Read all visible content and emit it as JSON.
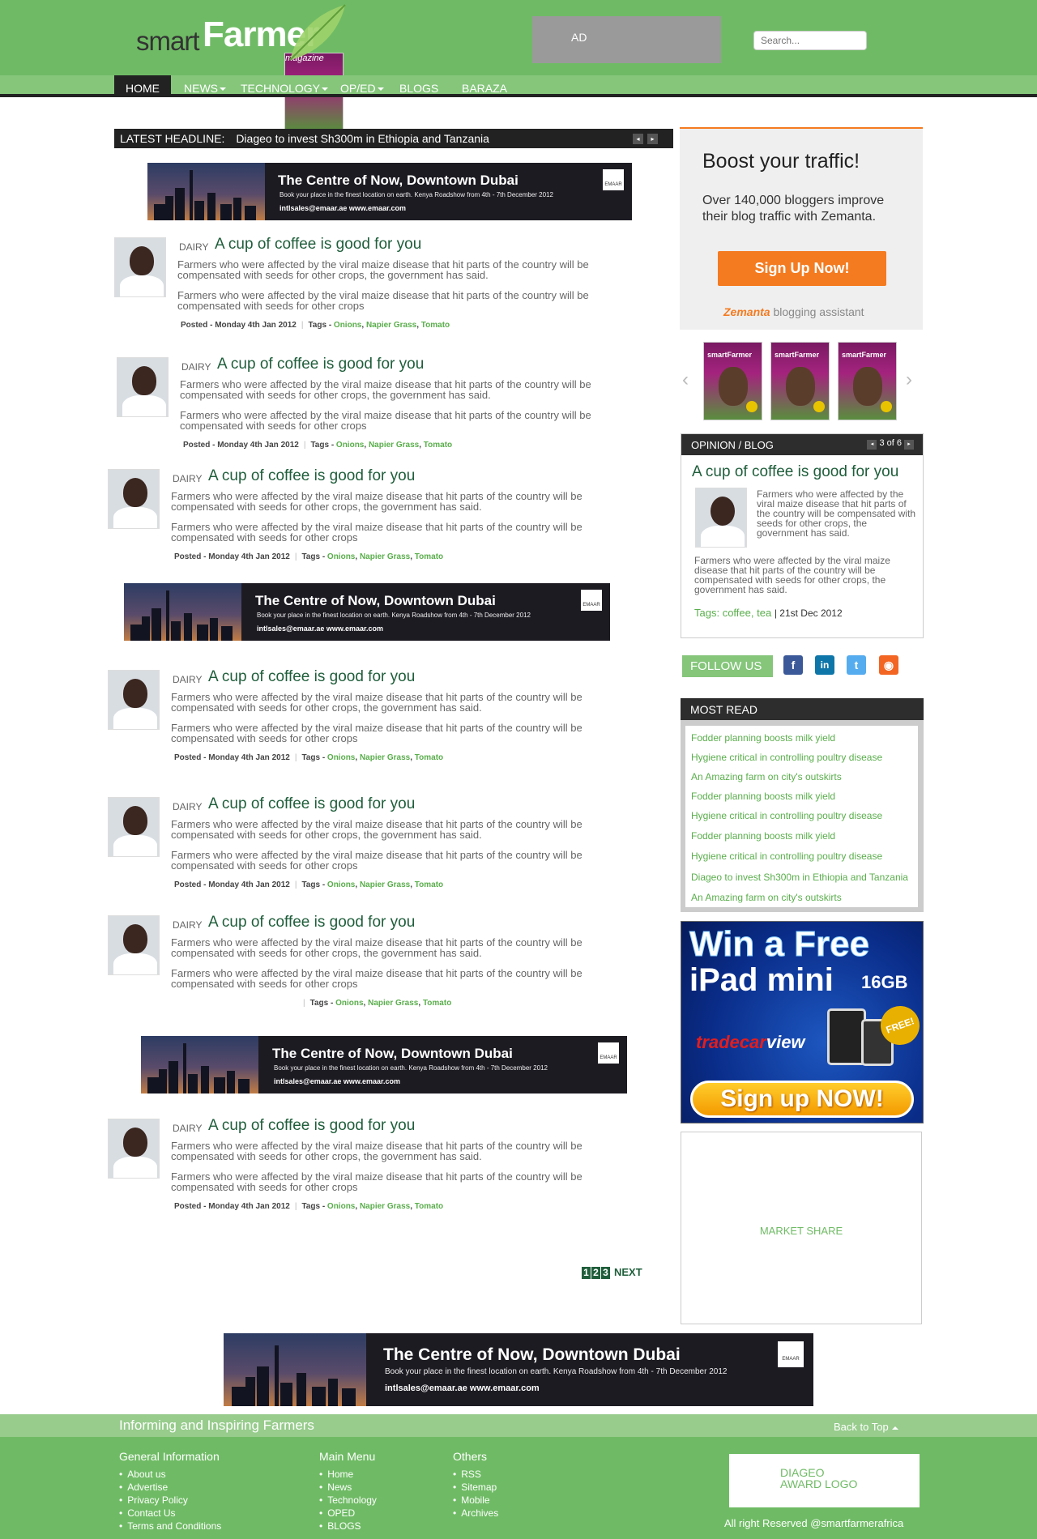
{
  "header": {
    "logo_smart": "smart",
    "logo_farmer": "Farmer",
    "logo_magazine": "magazine",
    "ad_label": "AD",
    "search_placeholder": "Search..."
  },
  "nav": {
    "items": [
      {
        "label": "HOME",
        "dropdown": false,
        "active": true
      },
      {
        "label": "NEWS",
        "dropdown": true
      },
      {
        "label": "TECHNOLOGY",
        "dropdown": true
      },
      {
        "label": "OP/ED",
        "dropdown": true
      },
      {
        "label": "BLOGS",
        "dropdown": false
      },
      {
        "label": "BARAZA",
        "dropdown": false
      }
    ]
  },
  "headline": {
    "label": "LATEST HEADLINE:",
    "text": "Diageo to invest Sh300m in Ethiopia and Tanzania",
    "prev": "◂",
    "next": "▸"
  },
  "banner": {
    "title": "The Centre of Now, Downtown Dubai",
    "subtitle": "Book your place in the finest location on earth. Kenya Roadshow from 4th - 7th December 2012",
    "contact": "intlsales@emaar.ae  www.emaar.com",
    "brand": "EMAAR"
  },
  "articles": [
    {
      "category": "DAIRY",
      "title": "A cup of coffee is good for you",
      "para1": "Farmers who were affected by the viral maize disease that hit parts of the country will be compensated with seeds for other crops, the government has said.",
      "para2": "Farmers who were affected by the viral maize disease that hit parts of the country will be compensated with seeds for other crops",
      "posted": "Posted - Monday 4th Jan 2012",
      "tags_label": "Tags - ",
      "tags": [
        "Onions",
        "Napier Grass",
        "Tomato"
      ]
    },
    {
      "category": "DAIRY",
      "title": "A cup of coffee is good for you",
      "para1": "Farmers who were affected by the viral maize disease that hit parts of the country will be compensated with seeds for other crops, the government has said.",
      "para2": "Farmers who were affected by the viral maize disease that hit parts of the country will be compensated with seeds for other crops",
      "posted": "Posted - Monday 4th Jan 2012",
      "tags_label": "Tags - ",
      "tags": [
        "Onions",
        "Napier Grass",
        "Tomato"
      ]
    },
    {
      "category": "DAIRY",
      "title": "A cup of coffee is good for you",
      "para1": "Farmers who were affected by the viral maize disease that hit parts of the country will be compensated with seeds for other crops, the government has said.",
      "para2": "Farmers who were affected by the viral maize disease that hit parts of the country will be compensated with seeds for other crops",
      "posted": "Posted - Monday 4th Jan 2012",
      "tags_label": "Tags - ",
      "tags": [
        "Onions",
        "Napier Grass",
        "Tomato"
      ]
    },
    {
      "category": "DAIRY",
      "title": "A cup of coffee is good for you",
      "para1": "Farmers who were affected by the viral maize disease that hit parts of the country will be compensated with seeds for other crops, the government has said.",
      "para2": "Farmers who were affected by the viral maize disease that hit parts of the country will be compensated with seeds for other crops",
      "posted": "Posted - Monday 4th Jan 2012",
      "tags_label": "Tags - ",
      "tags": [
        "Onions",
        "Napier Grass",
        "Tomato"
      ]
    },
    {
      "category": "DAIRY",
      "title": "A cup of coffee is good for you",
      "para1": "Farmers who were affected by the viral maize disease that hit parts of the country will be compensated with seeds for other crops, the government has said.",
      "para2": "Farmers who were affected by the viral maize disease that hit parts of the country will be compensated with seeds for other crops",
      "posted": "Posted - Monday 4th Jan 2012",
      "tags_label": "Tags - ",
      "tags": [
        "Onions",
        "Napier Grass",
        "Tomato"
      ]
    },
    {
      "category": "DAIRY",
      "title": "A cup of coffee is good for you",
      "para1": "Farmers who were affected by the viral maize disease that hit parts of the country will be compensated with seeds for other crops, the government has said.",
      "para2": "Farmers who were affected by the viral maize disease that hit parts of the country will be compensated with seeds for other crops",
      "posted": "",
      "tags_label": "Tags - ",
      "tags": [
        "Onions",
        "Napier Grass",
        "Tomato"
      ]
    },
    {
      "category": "DAIRY",
      "title": "A cup of coffee is good for you",
      "para1": "Farmers who were affected by the viral maize disease that hit parts of the country will be compensated with seeds for other crops, the government has said.",
      "para2": "Farmers who were affected by the viral maize disease that hit parts of the country will be compensated with seeds for other crops",
      "posted": "Posted - Monday 4th Jan 2012",
      "tags_label": "Tags - ",
      "tags": [
        "Onions",
        "Napier Grass",
        "Tomato"
      ]
    }
  ],
  "pager": {
    "pages": [
      "1",
      "2",
      "3"
    ],
    "next": "NEXT"
  },
  "zemanta": {
    "title": "Boost your traffic!",
    "desc": "Over 140,000 bloggers improve their blog traffic with Zemanta.",
    "button": "Sign Up Now!",
    "brand": "Zemanta",
    "brand_suffix": "blogging assistant"
  },
  "magazines": {
    "cover_title": "smartFarmer",
    "count": 3
  },
  "opinion": {
    "header": "OPINION / BLOG",
    "counter": "3 of 6",
    "title": "A cup of coffee is good for you",
    "para1": "Farmers who were affected by the viral maize disease that hit parts of the country will be compensated with seeds for other crops, the government  has said.",
    "para2": "Farmers who were affected by the viral maize disease that hit parts of the country will be compensated with seeds for other crops, the government has said.",
    "tags_label": "Tags:",
    "tags": "coffee, tea",
    "date": "21st Dec 2012"
  },
  "follow": {
    "label": "FOLLOW US",
    "icons": [
      {
        "name": "facebook-icon",
        "glyph": "f",
        "color": "#3b5998"
      },
      {
        "name": "linkedin-icon",
        "glyph": "in",
        "color": "#0e76a8"
      },
      {
        "name": "twitter-icon",
        "glyph": "t",
        "color": "#55acee"
      },
      {
        "name": "rss-icon",
        "glyph": "◉",
        "color": "#f26522"
      }
    ]
  },
  "most_read": {
    "header": "MOST READ",
    "items": [
      "Fodder planning boosts milk yield",
      "Hygiene critical in controlling poultry disease",
      "An Amazing farm on city's outskirts",
      "Fodder planning boosts milk yield",
      "Hygiene critical in controlling poultry disease",
      "Fodder planning boosts milk yield",
      "Hygiene critical in controlling poultry disease",
      "Diageo to invest Sh300m in Ethiopia and Tanzania",
      "An Amazing farm on city's outskirts"
    ]
  },
  "ipad_ad": {
    "line1": "Win a Free",
    "line2": "iPad mini",
    "size": "16GB",
    "brand_a": "tradecar",
    "brand_b": "view",
    "free": "FREE!",
    "button": "Sign up NOW!"
  },
  "market_share": "MARKET SHARE",
  "footer": {
    "tagline": "Informing and Inspiring Farmers",
    "back_to_top": "Back to Top",
    "general_heading": "General Information",
    "general": [
      "About us",
      "Advertise",
      "Privacy Policy",
      "Contact Us",
      "Terms and Conditions"
    ],
    "main_heading": "Main Menu",
    "main": [
      "Home",
      "News",
      "Technology",
      "OPED",
      "BLOGS"
    ],
    "others_heading": "Others",
    "others": [
      "RSS",
      "Sitemap",
      "Mobile",
      "Archives"
    ],
    "award_line1": "DIAGEO",
    "award_line2": "AWARD LOGO",
    "rights": "All right Reserved @smartfarmerafrica"
  },
  "colors": {
    "brand_green": "#6fbb65",
    "dark_green": "#1f5e3b",
    "accent_orange": "#f47b20"
  }
}
